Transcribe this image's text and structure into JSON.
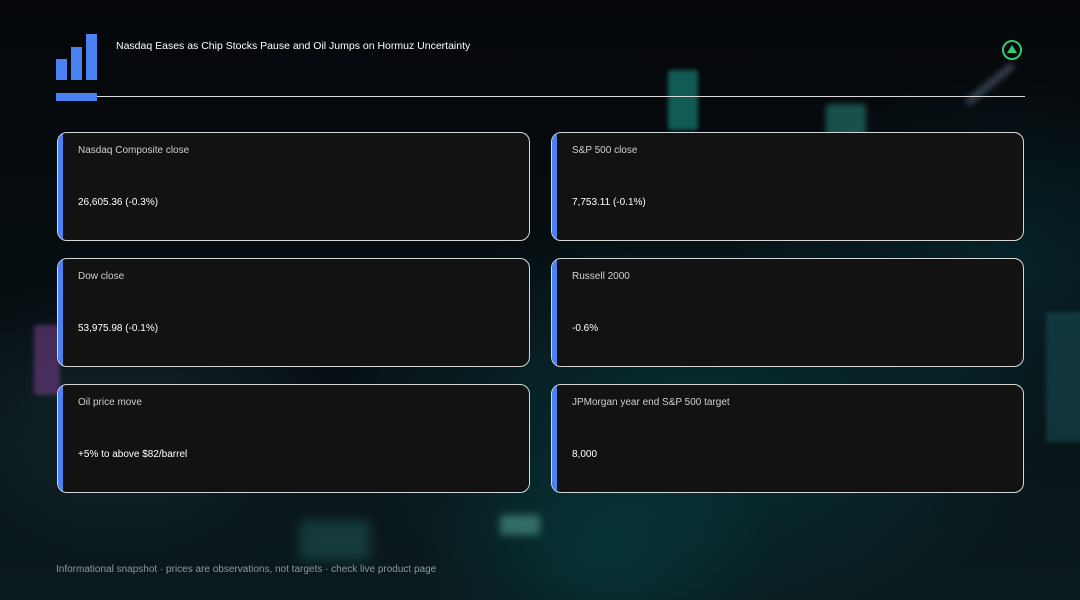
{
  "header": {
    "title": "Nasdaq Eases as Chip Stocks Pause and Oil Jumps on Hormuz Uncertainty",
    "logo_icon": "bar-chart-icon",
    "status_icon": "up-triangle-icon",
    "status_color": "#2ecc71"
  },
  "accent_color": "#4a82f4",
  "cards": [
    {
      "label": "Nasdaq Composite close",
      "value": "26,605.36 (-0.3%)"
    },
    {
      "label": "S&P 500 close",
      "value": "7,753.11 (-0.1%)"
    },
    {
      "label": "Dow close",
      "value": "53,975.98 (-0.1%)"
    },
    {
      "label": "Russell 2000",
      "value": "-0.6%"
    },
    {
      "label": "Oil price move",
      "value": "+5% to above $82/barrel"
    },
    {
      "label": "JPMorgan year end S&P 500 target",
      "value": "8,000"
    }
  ],
  "footer": {
    "note": "Informational snapshot · prices are observations, not targets · check live product page"
  }
}
